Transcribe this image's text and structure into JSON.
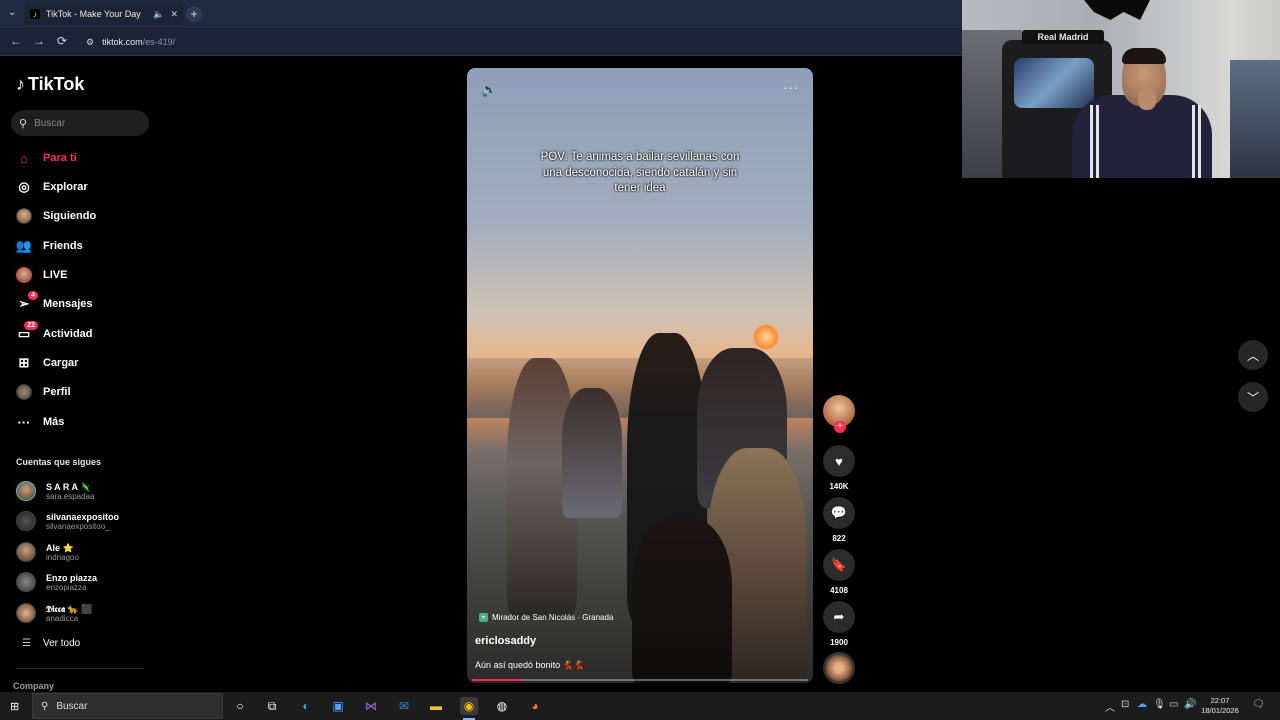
{
  "browser": {
    "tab_title": "TikTok - Make Your Day",
    "url_domain": "tiktok.com",
    "url_path": "/es-419/",
    "new_tab": "+"
  },
  "sidebar": {
    "brand": "TikTok",
    "search_placeholder": "Buscar",
    "nav": [
      {
        "label": "Para ti",
        "icon": "home-icon",
        "active": true
      },
      {
        "label": "Explorar",
        "icon": "compass-icon"
      },
      {
        "label": "Siguiendo",
        "icon": "avatar-icon"
      },
      {
        "label": "Friends",
        "icon": "friends-icon"
      },
      {
        "label": "LIVE",
        "icon": "live-avatar-icon"
      },
      {
        "label": "Mensajes",
        "icon": "paper-plane-icon",
        "badge": "4"
      },
      {
        "label": "Actividad",
        "icon": "activity-icon",
        "badge": "22"
      },
      {
        "label": "Cargar",
        "icon": "plus-square-icon"
      },
      {
        "label": "Perfil",
        "icon": "profile-avatar-icon"
      },
      {
        "label": "Más",
        "icon": "more-icon"
      }
    ],
    "following_title": "Cuentas que sigues",
    "following": [
      {
        "name": "S A R A 🦎",
        "user": "sara.espadaa"
      },
      {
        "name": "silvanaexpositoo",
        "user": "silvanaexpositoo_"
      },
      {
        "name": "Ale ⭐",
        "user": "indriagoo"
      },
      {
        "name": "Enzo piazza",
        "user": "enzopiazza"
      },
      {
        "name": "𝕯𝖎𝖈𝖈𝖆 🐆 ⬛",
        "user": "anadicca"
      }
    ],
    "see_all": "Ver todo",
    "company": "Company"
  },
  "video": {
    "caption": "POV: Te animas a bailar sevillanas con una desconocida, siendo catalán y sin tener idea",
    "location": "Mirador de San Nicolás · Granada",
    "author": "ericlosaddy",
    "description": "Aún así quedó bonito 💃💃",
    "progress": 0.15
  },
  "actions": {
    "likes": "140K",
    "comments": "822",
    "saves": "4108",
    "shares": "1900"
  },
  "webcam": {
    "chair_brand": "Real Madrid"
  },
  "taskbar": {
    "search": "Buscar",
    "time": "22:07",
    "date": "18/01/2026"
  },
  "colors": {
    "accent": "#fe2c55",
    "background": "#000000"
  }
}
